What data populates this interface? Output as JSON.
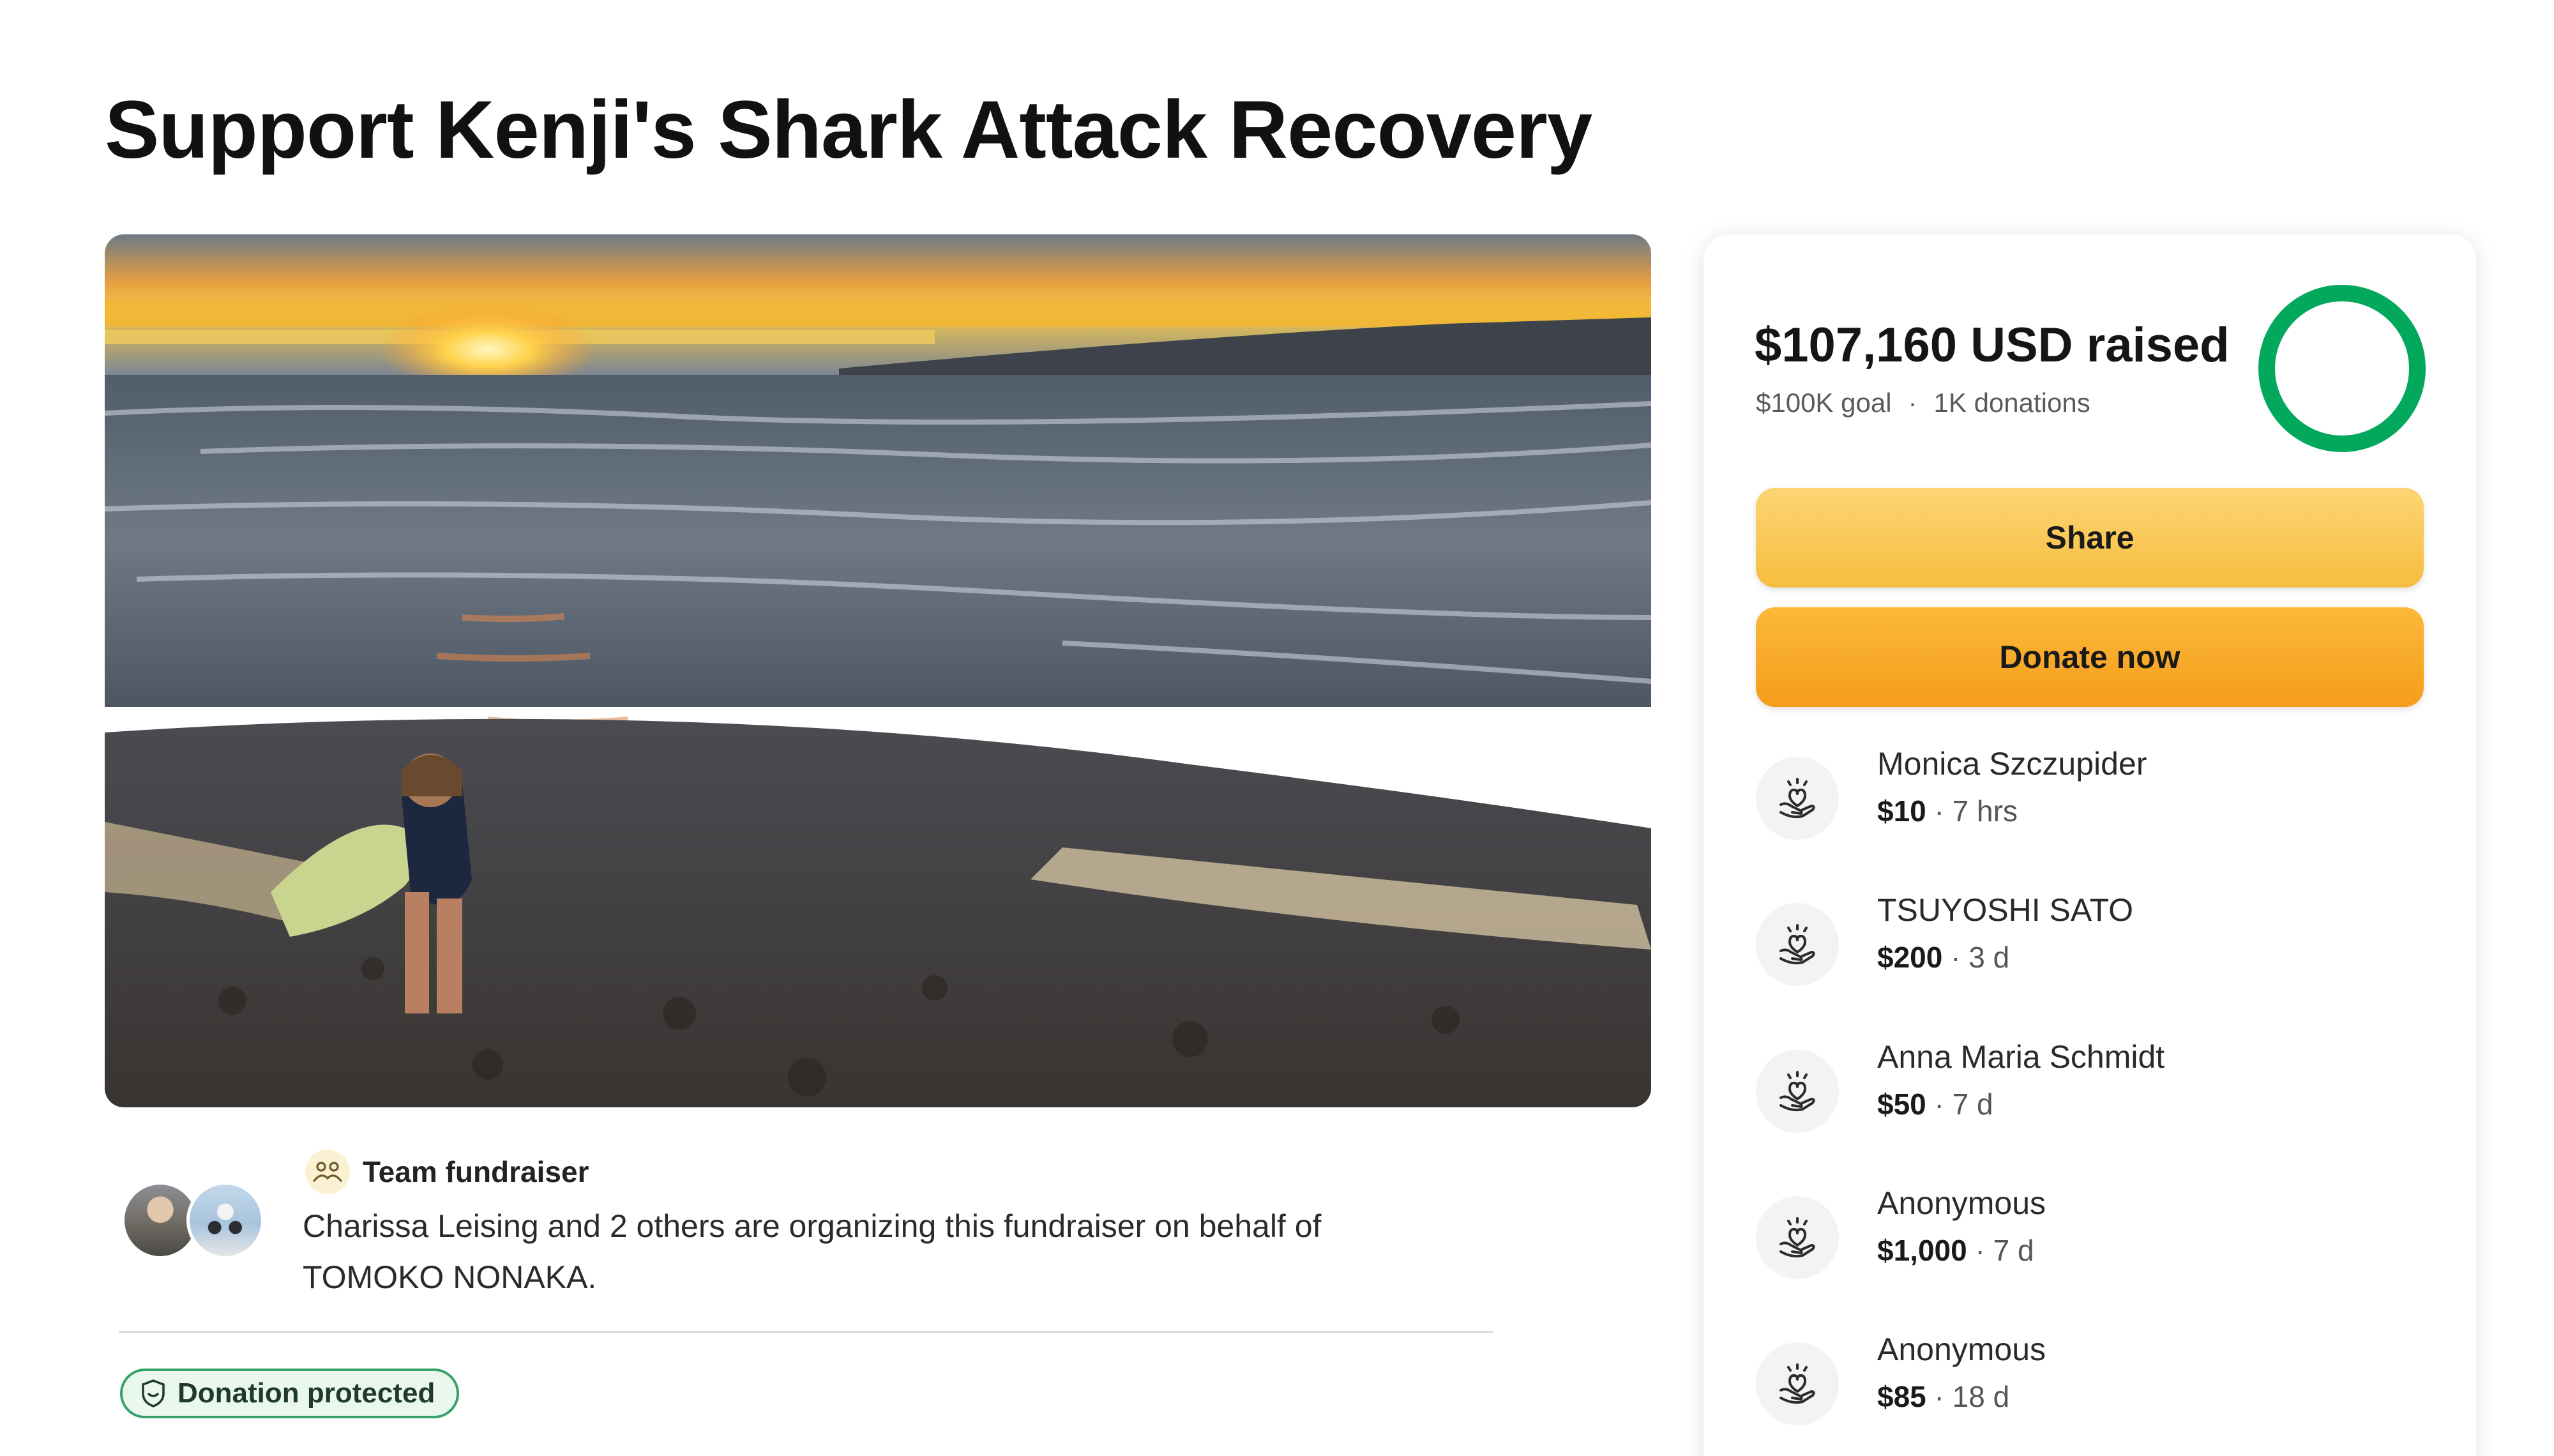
{
  "campaign": {
    "title": "Support Kenji's Shark Attack Recovery"
  },
  "organizer": {
    "team_label": "Team fundraiser",
    "text": "Charissa Leising and 2 others are organizing this fundraiser on behalf of TOMOKO NONAKA.",
    "badge": "Donation protected"
  },
  "progress": {
    "raised": "$107,160 USD raised",
    "goal": "$100K goal",
    "separator": "·",
    "donations": "1K donations",
    "fraction": 1.0,
    "color": "#02a95c"
  },
  "actions": {
    "share_label": "Share",
    "donate_label": "Donate now"
  },
  "donations": [
    {
      "name": "Monica Szczupider",
      "amount": "$10",
      "time": "· 7 hrs"
    },
    {
      "name": "TSUYOSHI SATO",
      "amount": "$200",
      "time": "· 3 d"
    },
    {
      "name": "Anna Maria Schmidt",
      "amount": "$50",
      "time": "· 7 d"
    },
    {
      "name": "Anonymous",
      "amount": "$1,000",
      "time": "· 7 d"
    },
    {
      "name": "Anonymous",
      "amount": "$85",
      "time": "· 18 d"
    }
  ],
  "icons": {
    "team": "team-icon",
    "shield": "shield-icon",
    "donor": "heart-hand-icon"
  }
}
